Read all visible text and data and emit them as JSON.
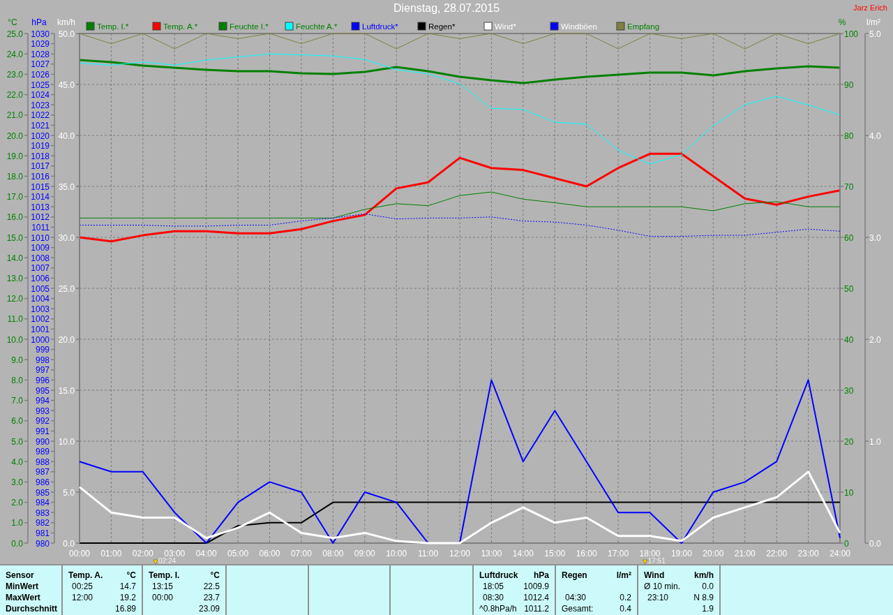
{
  "window": {
    "title": "Dienstag, 28.07.2015",
    "user": "Jarz Erich"
  },
  "chart": {
    "panes": [
      {
        "chart_data": {
          "type": "line",
          "ylabel": "°C",
          "xlim": [
            0,
            24
          ],
          "ylim": [
            0,
            25
          ],
          "x": [
            0,
            1,
            2,
            3,
            4,
            5,
            6,
            7,
            8,
            9,
            10,
            11,
            12,
            13,
            14,
            15,
            16,
            17,
            18,
            19,
            20,
            21,
            22,
            23,
            24
          ],
          "xticks": [
            {
              "value": 0,
              "label": "00:00"
            },
            {
              "value": 1,
              "label": "01:00"
            },
            {
              "value": 2,
              "label": "02:00"
            },
            {
              "value": 3,
              "label": "03:00"
            },
            {
              "value": 4,
              "label": "04:00"
            },
            {
              "value": 5,
              "label": "05:00"
            },
            {
              "value": 6,
              "label": "06:00"
            },
            {
              "value": 7,
              "label": "07:00"
            },
            {
              "value": 8,
              "label": "08:00"
            },
            {
              "value": 9,
              "label": "09:00"
            },
            {
              "value": 10,
              "label": "10:00"
            },
            {
              "value": 11,
              "label": "11:00"
            },
            {
              "value": 12,
              "label": "12:00"
            },
            {
              "value": 13,
              "label": "13:00"
            },
            {
              "value": 14,
              "label": "14:00"
            },
            {
              "value": 15,
              "label": "15:00"
            },
            {
              "value": 16,
              "label": "16:00"
            },
            {
              "value": 17,
              "label": "17:00"
            },
            {
              "value": 18,
              "label": "18:00"
            },
            {
              "value": 19,
              "label": "19:00"
            },
            {
              "value": 20,
              "label": "20:00"
            },
            {
              "value": 21,
              "label": "21:00"
            },
            {
              "value": 22,
              "label": "22:00"
            },
            {
              "value": 23,
              "label": "23:00"
            },
            {
              "value": 24,
              "label": "24:00"
            }
          ],
          "yticks": [
            {
              "value": 25,
              "label": "25.0"
            },
            {
              "value": 24,
              "label": "24.0"
            },
            {
              "value": 23,
              "label": "23.0"
            },
            {
              "value": 22,
              "label": "22.0"
            },
            {
              "value": 21,
              "label": "21.0"
            },
            {
              "value": 20,
              "label": "20.0"
            },
            {
              "value": 19,
              "label": "19.0"
            },
            {
              "value": 18,
              "label": "18.0"
            },
            {
              "value": 17,
              "label": "17.0"
            },
            {
              "value": 16,
              "label": "16.0"
            },
            {
              "value": 15,
              "label": "15.0"
            },
            {
              "value": 14,
              "label": "14.0"
            },
            {
              "value": 13,
              "label": "13.0"
            },
            {
              "value": 12,
              "label": "12.0"
            },
            {
              "value": 11,
              "label": "11.0"
            },
            {
              "value": 10,
              "label": "10.0"
            },
            {
              "value": 9,
              "label": "9.0"
            },
            {
              "value": 8,
              "label": "8.0"
            },
            {
              "value": 7,
              "label": "7.0"
            },
            {
              "value": 6,
              "label": "6.0"
            },
            {
              "value": 5,
              "label": "5.0"
            },
            {
              "value": 4,
              "label": "4.0"
            },
            {
              "value": 3,
              "label": "3.0"
            },
            {
              "value": 2,
              "label": "2.0"
            },
            {
              "value": 1,
              "label": "1.0"
            },
            {
              "value": 0,
              "label": "0.0"
            }
          ],
          "series": [
            {
              "name": "Temp. I.*",
              "color": "#008000",
              "values": [
                23.7,
                23.6,
                23.42,
                23.32,
                23.22,
                23.15,
                23.15,
                23.05,
                23.01,
                23.12,
                23.36,
                23.15,
                22.88,
                22.71,
                22.57,
                22.74,
                22.88,
                22.98,
                23.08,
                23.08,
                22.95,
                23.15,
                23.29,
                23.39,
                23.32
              ]
            },
            {
              "name": "Temp. A.*",
              "color": "#ff0000",
              "values": [
                15.0,
                14.8,
                15.1,
                15.3,
                15.3,
                15.2,
                15.2,
                15.4,
                15.8,
                16.1,
                17.4,
                17.7,
                18.9,
                18.4,
                18.3,
                17.9,
                17.5,
                18.4,
                19.1,
                19.1,
                18.0,
                16.9,
                16.6,
                17.0,
                17.3
              ]
            }
          ]
        }
      },
      {
        "chart_data": {
          "type": "line",
          "ylabel": "%",
          "xlim": [
            0,
            24
          ],
          "ylim": [
            0,
            100
          ],
          "x": [
            0,
            1,
            2,
            3,
            4,
            5,
            6,
            7,
            8,
            9,
            10,
            11,
            12,
            13,
            14,
            15,
            16,
            17,
            18,
            19,
            20,
            21,
            22,
            23,
            24
          ],
          "yticks": [
            100,
            90,
            80,
            70,
            60,
            50,
            40,
            30,
            20,
            10,
            0
          ],
          "series": [
            {
              "name": "Feuchte I.*",
              "color": "#008000",
              "values": [
                63.8,
                63.8,
                63.8,
                63.8,
                63.8,
                63.8,
                63.8,
                63.8,
                63.8,
                65.5,
                66.6,
                66.2,
                68.2,
                68.9,
                67.5,
                66.8,
                66.0,
                66.0,
                66.0,
                66.0,
                65.2,
                66.6,
                67.0,
                66.0,
                66.0
              ]
            },
            {
              "name": "Feuchte A.*",
              "color": "#00ffff",
              "values": [
                94.2,
                93.8,
                94.4,
                93.8,
                94.8,
                95.4,
                96.0,
                95.8,
                95.6,
                94.9,
                92.9,
                92.1,
                90.1,
                85.3,
                85.1,
                82.6,
                82.2,
                77.1,
                74.4,
                76.2,
                81.9,
                86.0,
                87.7,
                86.0,
                84.0
              ]
            }
          ]
        }
      },
      {
        "chart_data": {
          "type": "line",
          "ylabel": "hPa",
          "xlim": [
            0,
            24
          ],
          "ylim": [
            980,
            1030
          ],
          "x": [
            0,
            1,
            2,
            3,
            4,
            5,
            6,
            7,
            8,
            9,
            10,
            11,
            12,
            13,
            14,
            15,
            16,
            17,
            18,
            19,
            20,
            21,
            22,
            23,
            24
          ],
          "yticks": [
            1030,
            1029,
            1028,
            1027,
            1026,
            1025,
            1024,
            1023,
            1022,
            1021,
            1020,
            1019,
            1018,
            1017,
            1016,
            1015,
            1014,
            1013,
            1012,
            1011,
            1010,
            1009,
            1008,
            1007,
            1006,
            1005,
            1004,
            1003,
            1002,
            1001,
            1000,
            999,
            998,
            997,
            996,
            995,
            994,
            993,
            992,
            991,
            990,
            989,
            988,
            987,
            986,
            985,
            984,
            983,
            982,
            981,
            980
          ],
          "series": [
            {
              "name": "Luftdruck*",
              "color": "#0000ff",
              "line_style": "dotted",
              "values": [
                1011.2,
                1011.2,
                1011.2,
                1011.1,
                1011.1,
                1011.2,
                1011.2,
                1011.6,
                1011.9,
                1012.3,
                1011.8,
                1011.9,
                1011.9,
                1012.0,
                1011.6,
                1011.5,
                1011.2,
                1010.7,
                1010.1,
                1010.1,
                1010.2,
                1010.2,
                1010.5,
                1010.8,
                1010.6
              ]
            }
          ]
        }
      },
      {
        "chart_data": {
          "type": "line",
          "ylabel": "l/m²",
          "xlim": [
            0,
            24
          ],
          "ylim": [
            0,
            5
          ],
          "x": [
            0,
            1,
            2,
            3,
            4,
            5,
            6,
            7,
            8,
            9,
            10,
            11,
            12,
            13,
            14,
            15,
            16,
            17,
            18,
            19,
            20,
            21,
            22,
            23,
            24
          ],
          "yticks": [
            {
              "value": 5,
              "label": "5.0"
            },
            {
              "value": 4,
              "label": "4.0"
            },
            {
              "value": 3,
              "label": "3.0"
            },
            {
              "value": 2,
              "label": "2.0"
            },
            {
              "value": 1,
              "label": "1.0"
            },
            {
              "value": 0,
              "label": "0.0"
            }
          ],
          "series": [
            {
              "name": "Regen*",
              "color": "#000000",
              "values": [
                0,
                0,
                0,
                0,
                0,
                0.17,
                0.2,
                0.2,
                0.4,
                0.4,
                0.4,
                0.4,
                0.4,
                0.4,
                0.4,
                0.4,
                0.4,
                0.4,
                0.4,
                0.4,
                0.4,
                0.4,
                0.4,
                0.4,
                0.4
              ]
            }
          ]
        }
      },
      {
        "chart_data": {
          "type": "line",
          "ylabel": "km/h",
          "xlim": [
            0,
            24
          ],
          "ylim": [
            0,
            50
          ],
          "x": [
            0,
            1,
            2,
            3,
            4,
            5,
            6,
            7,
            8,
            9,
            10,
            11,
            12,
            13,
            14,
            15,
            16,
            17,
            18,
            19,
            20,
            21,
            22,
            23,
            24
          ],
          "yticks": [
            {
              "value": 50,
              "label": "50.0"
            },
            {
              "value": 45,
              "label": "45.0"
            },
            {
              "value": 40,
              "label": "40.0"
            },
            {
              "value": 35,
              "label": "35.0"
            },
            {
              "value": 30,
              "label": "30.0"
            },
            {
              "value": 25,
              "label": "25.0"
            },
            {
              "value": 20,
              "label": "20.0"
            },
            {
              "value": 15,
              "label": "15.0"
            },
            {
              "value": 10,
              "label": "10.0"
            },
            {
              "value": 5,
              "label": "5.0"
            },
            {
              "value": 0,
              "label": "0.0"
            }
          ],
          "series": [
            {
              "name": "Wind*",
              "color": "#ffffff",
              "values": [
                5.5,
                3.0,
                2.5,
                2.5,
                0.5,
                1.5,
                3.0,
                1.0,
                0.5,
                1.0,
                0.2,
                0,
                0,
                2.0,
                3.5,
                2.0,
                2.5,
                0.7,
                0.7,
                0.2,
                2.5,
                3.5,
                4.5,
                7.0,
                1.0
              ]
            },
            {
              "name": "Windböen",
              "color": "#0000ff",
              "values": [
                8,
                7,
                7,
                3,
                0,
                4,
                6,
                5,
                0,
                5,
                4,
                0,
                0,
                16,
                8,
                13,
                8,
                3,
                3,
                0,
                5,
                6,
                8,
                16,
                0.5
              ]
            }
          ],
          "annotations": [
            "02:24",
            "17:51"
          ]
        }
      },
      {
        "chart_data": {
          "type": "line",
          "xlim": [
            0,
            24
          ],
          "ylim": [
            0,
            100
          ],
          "x": [
            0,
            1,
            2,
            3,
            4,
            5,
            6,
            7,
            8,
            9,
            10,
            11,
            12,
            13,
            14,
            15,
            16,
            17,
            18,
            19,
            20,
            21,
            22,
            23,
            24
          ],
          "series": [
            {
              "name": "Empfang",
              "color": "#808040",
              "values": [
                100,
                98,
                100,
                97,
                100,
                99,
                100,
                98,
                100,
                100,
                97,
                100,
                99,
                100,
                98,
                100,
                100,
                97,
                100,
                99,
                100,
                97,
                100,
                98,
                100
              ]
            }
          ]
        }
      }
    ]
  },
  "summary": {
    "columns": [
      {
        "kind": "labels",
        "title": "Sensor",
        "min": "MinWert",
        "max": "MaxWert",
        "avg": "Durchschnitt"
      },
      {
        "kind": "sensor",
        "title": "Temp. A.",
        "unit": "°C",
        "min": {
          "time": "00:25",
          "value": "14.7"
        },
        "max": {
          "time": "12:00",
          "value": "19.2"
        },
        "avg": {
          "value": "16.89"
        }
      },
      {
        "kind": "sensor",
        "title": "Temp. I.",
        "unit": "°C",
        "min": {
          "time": "13:15",
          "value": "22.5"
        },
        "max": {
          "time": "00:00",
          "value": "23.7"
        },
        "avg": {
          "value": "23.09"
        }
      },
      {
        "kind": "empty"
      },
      {
        "kind": "empty"
      },
      {
        "kind": "empty"
      },
      {
        "kind": "sensor",
        "title": "Luftdruck",
        "unit": "hPa",
        "min": {
          "time": "18:05",
          "value": "1009.9"
        },
        "max": {
          "time": "08:30",
          "value": "1012.4"
        },
        "avg": {
          "label": "^0.8hPa/h",
          "value": "1011.2"
        }
      },
      {
        "kind": "sensor",
        "title": "Regen",
        "unit": "l/m²",
        "max": {
          "time": "04:30",
          "value": "0.2"
        },
        "avg": {
          "label": "Gesamt:",
          "value": "0.4"
        }
      },
      {
        "kind": "sensor",
        "title": "Wind",
        "unit": "km/h",
        "min": {
          "label": "Ø 10 min.",
          "value": "0.0"
        },
        "max": {
          "time": "23:10",
          "value": "N 8.9"
        },
        "avg": {
          "value": "1.9"
        }
      },
      {
        "kind": "empty"
      }
    ]
  }
}
